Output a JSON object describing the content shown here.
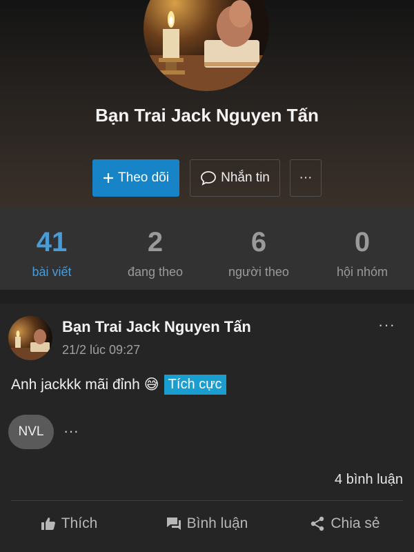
{
  "profile": {
    "name": "Bạn Trai Jack Nguyen Tấn",
    "follow_label": "Theo dõi",
    "message_label": "Nhắn tin",
    "more_label": "···"
  },
  "stats": [
    {
      "value": "41",
      "label": "bài viết",
      "active": true
    },
    {
      "value": "2",
      "label": "đang theo",
      "active": false
    },
    {
      "value": "6",
      "label": "người theo",
      "active": false
    },
    {
      "value": "0",
      "label": "hội nhóm",
      "active": false
    }
  ],
  "post": {
    "author": "Bạn Trai Jack Nguyen Tấn",
    "time": "21/2 lúc 09:27",
    "menu_label": "···",
    "text": "Anh jackkk mãi đỉnh",
    "emoji": "😅",
    "tag": "Tích cực",
    "reactor_initials": "NVL",
    "reactor_more": "···",
    "comment_count": "4 bình luận"
  },
  "actions": {
    "like": "Thích",
    "comment": "Bình luận",
    "share": "Chia sẻ"
  },
  "colors": {
    "accent": "#1784c8",
    "stat_active": "#4a9bd6",
    "tag_bg": "#1a9dcf"
  },
  "icons": [
    "candle-photo-avatar",
    "plus-icon",
    "chat-bubble-icon",
    "thumbs-up-icon",
    "comment-icon",
    "share-icon"
  ]
}
